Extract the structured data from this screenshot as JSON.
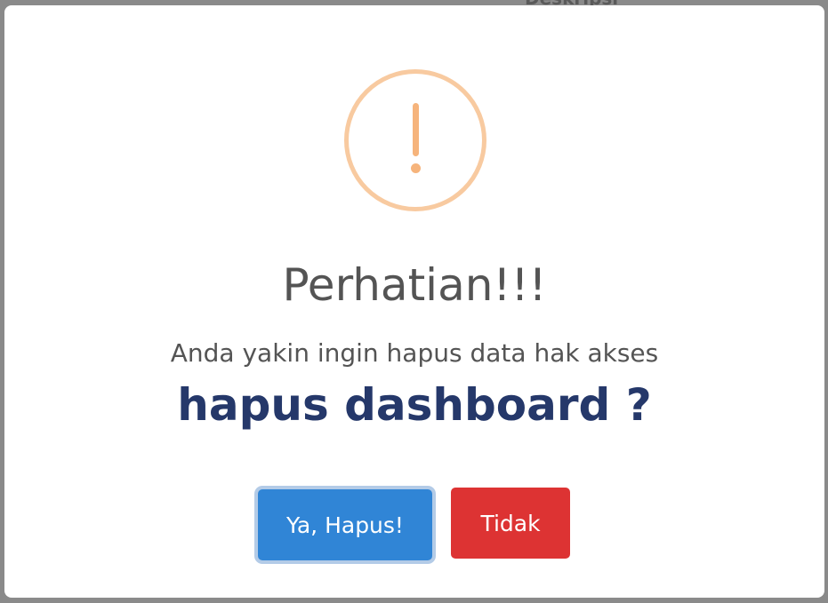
{
  "background": {
    "partial_heading": "Deskripsi"
  },
  "dialog": {
    "title": "Perhatian!!!",
    "message": "Anda yakin ingin hapus data hak akses",
    "target": "hapus dashboard ?",
    "icon": "warning-exclamation-icon",
    "confirm_label": "Ya, Hapus!",
    "cancel_label": "Tidak"
  },
  "colors": {
    "icon_ring": "#f8caa0",
    "icon_mark": "#f6b47c",
    "confirm": "#3085d6",
    "cancel": "#dd3333",
    "target_text": "#25386a",
    "overlay": "#8a8a8a"
  }
}
